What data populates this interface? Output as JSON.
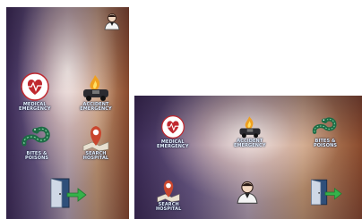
{
  "portrait": {
    "items": [
      {
        "id": "medical",
        "label": "MEDICAL\nEMERGENCY",
        "icon": "heart-icon"
      },
      {
        "id": "accident",
        "label": "ACCIDENT\nEMERGENCY",
        "icon": "fire-car-icon"
      },
      {
        "id": "bites",
        "label": "BITES &\nPOISONS",
        "icon": "snake-icon"
      },
      {
        "id": "hospital",
        "label": "SEARCH\nHOSPITAL",
        "icon": "map-pin-icon"
      }
    ],
    "profile_icon": "user-icon",
    "exit_icon": "exit-door-icon"
  },
  "landscape": {
    "items": [
      {
        "id": "medical",
        "label": "MEDICAL\nEMERGENCY",
        "icon": "heart-icon"
      },
      {
        "id": "accident",
        "label": "ACCIDENT\nEMERGENCY",
        "icon": "fire-car-icon"
      },
      {
        "id": "bites",
        "label": "BITES &\nPOISONS",
        "icon": "snake-icon"
      },
      {
        "id": "hospital",
        "label": "SEARCH\nHOSPITAL",
        "icon": "map-pin-icon"
      }
    ],
    "profile_icon": "user-icon",
    "exit_icon": "exit-door-icon"
  },
  "colors": {
    "heart": "#c0282f",
    "fire": "#f0a020",
    "snake": "#1d6b45",
    "pin": "#c9462e",
    "door_green": "#35b24a"
  }
}
